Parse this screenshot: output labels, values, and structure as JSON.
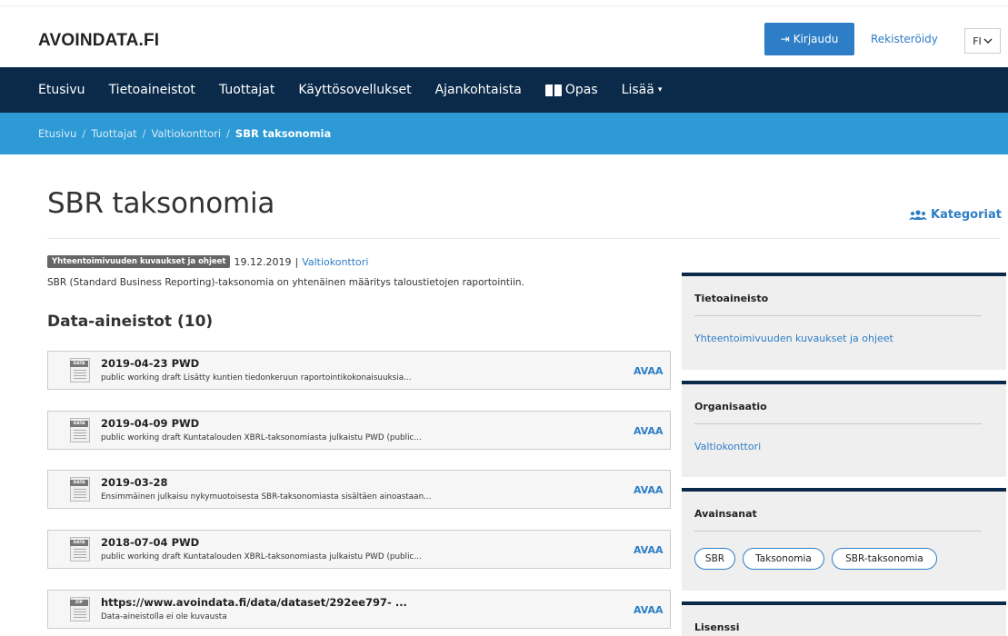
{
  "header": {
    "logo": "AVOINDATA.FI",
    "login_label": "Kirjaudu",
    "register_label": "Rekisteröidy",
    "language": "FI"
  },
  "nav": {
    "items": [
      "Etusivu",
      "Tietoaineistot",
      "Tuottajat",
      "Käyttösovellukset",
      "Ajankohtaista",
      "Opas",
      "Lisää"
    ]
  },
  "breadcrumb": {
    "items": [
      "Etusivu",
      "Tuottajat",
      "Valtiokonttori"
    ],
    "current": "SBR taksonomia"
  },
  "page": {
    "title": "SBR taksonomia",
    "categories_link": "Kategoriat",
    "badge": "Yhteentoimivuuden kuvaukset ja ohjeet",
    "date": "19.12.2019",
    "separator": "|",
    "organization": "Valtiokonttori",
    "description": "SBR (Standard Business Reporting)-taksonomia on yhtenäinen määritys taloustietojen raportointiin.",
    "resources_heading": "Data-aineistot (10)"
  },
  "resources": [
    {
      "icon_label": "DATA",
      "title": "2019-04-23 PWD",
      "desc": "public working draft Lisätty kuntien tiedonkeruun raportointikokonaisuuksia...",
      "open": "AVAA"
    },
    {
      "icon_label": "DATA",
      "title": "2019-04-09 PWD",
      "desc": "public working draft Kuntatalouden XBRL-taksonomiasta julkaistu PWD (public...",
      "open": "AVAA"
    },
    {
      "icon_label": "DATA",
      "title": "2019-03-28",
      "desc": "Ensimmäinen julkaisu nykymuotoisesta SBR-taksonomiasta sisältäen ainoastaan...",
      "open": "AVAA"
    },
    {
      "icon_label": "DATA",
      "title": "2018-07-04 PWD",
      "desc": "public working draft Kuntatalouden XBRL-taksonomiasta julkaistu PWD (public...",
      "open": "AVAA"
    },
    {
      "icon_label": "ZIP",
      "title": "https://www.avoindata.fi/data/dataset/292ee797- ...",
      "desc": "Data-aineistolla ei ole kuvausta",
      "open": "AVAA"
    }
  ],
  "sidebar": {
    "dataset_header": "Tietoaineisto",
    "dataset_link": "Yhteentoimivuuden kuvaukset ja ohjeet",
    "org_header": "Organisaatio",
    "org_link": "Valtiokonttori",
    "keywords_header": "Avainsanat",
    "keywords": [
      "SBR",
      "Taksonomia",
      "SBR-taksonomia"
    ],
    "license_header": "Lisenssi"
  },
  "colors": {
    "nav_bg": "#0b2a4a",
    "breadcrumb_bg": "#2d9ad6",
    "accent": "#2d7ec6"
  }
}
